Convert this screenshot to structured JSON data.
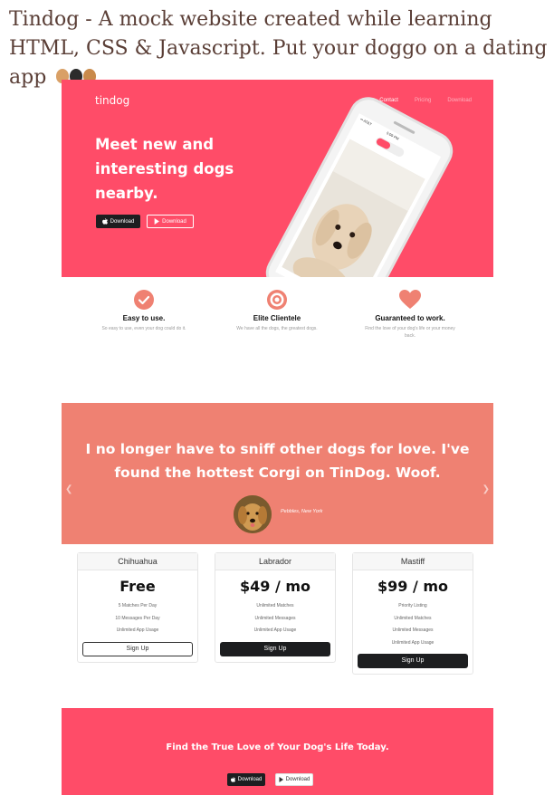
{
  "readme": {
    "title": "Tindog - A mock website created while learning HTML, CSS & Javascript. Put your doggo on a dating app"
  },
  "hero": {
    "logo": "tindog",
    "nav": [
      "Contact",
      "Pricing",
      "Download"
    ],
    "heading": "Meet new and interesting dogs nearby.",
    "download_apple": "Download",
    "download_play": "Download",
    "phone_carrier": "•• AT&T",
    "phone_time": "5:09 PM"
  },
  "features": [
    {
      "icon": "check-circle-icon",
      "title": "Easy to use.",
      "text": "So easy to use, even your dog could do it."
    },
    {
      "icon": "bullseye-icon",
      "title": "Elite Clientele",
      "text": "We have all the dogs, the greatest dogs."
    },
    {
      "icon": "heart-icon",
      "title": "Guaranteed to work.",
      "text": "Find the love of your dog's life or your money back."
    }
  ],
  "testimonial": {
    "quote": "I no longer have to sniff other dogs for love. I've found the hottest Corgi on TinDog. Woof.",
    "author": "Pebbles, New York"
  },
  "pricing": [
    {
      "plan": "Chihuahua",
      "price": "Free",
      "features": [
        "5 Matches Per Day",
        "10 Messages Per Day",
        "Unlimited App Usage"
      ],
      "button": "Sign Up",
      "style": "outline"
    },
    {
      "plan": "Labrador",
      "price": "$49 / mo",
      "features": [
        "Unlimited Matches",
        "Unlimited Messages",
        "Unlimited App Usage"
      ],
      "button": "Sign Up",
      "style": "dark"
    },
    {
      "plan": "Mastiff",
      "price": "$99 / mo",
      "features": [
        "Priority Listing",
        "Unlimited Matches",
        "Unlimited Messages",
        "Unlimited App Usage"
      ],
      "button": "Sign Up",
      "style": "dark"
    }
  ],
  "cta": {
    "title": "Find the True Love of Your Dog's Life Today.",
    "download_apple": "Download",
    "download_play": "Download"
  },
  "colors": {
    "brand": "#ff4c68",
    "testimonial_bg": "#ef8172",
    "feature_icon": "#ef8172",
    "button_dark": "#1d1e20"
  }
}
